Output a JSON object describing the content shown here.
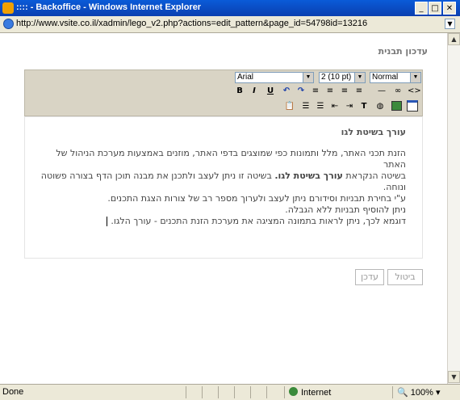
{
  "window": {
    "title": ":::: - Backoffice - Windows Internet Explorer",
    "address": "http://www.vsite.co.il/xadmin/lego_v2.php?actions=edit_pattern&page_id=54798id=13216"
  },
  "page": {
    "heading": "עדכון תבנית"
  },
  "toolbar": {
    "font_family": "Arial",
    "font_size": "2 (10 pt)",
    "format": "Normal"
  },
  "editor": {
    "title": "עורך בשיטת לגו",
    "line1": "הזנת תכני האתר, מלל ותמונות כפי שמוצגים בדפי האתר, מוזנים באמצעות מערכת הניהול של האתר",
    "line2_a": "בשיטה הנקראת ",
    "line2_b": "עורך בשיטת לגו.",
    "line2_c": " בשיטה זו ניתן לעצב ולתכנן את מבנה תוכן הדף בצורה פשוטה ונוחה.",
    "line3": "ע\"י בחירת תבניות וסידורם ניתן לעצב ולערוך מספר רב של צורות הצגת התכנים.",
    "line4": "ניתן להוסיף תבניות ללא הגבלה.",
    "line5": "דוגמא לכך, ניתן לראות בתמונה המציגה את מערכת הזנת התכנים - עורך הלגו."
  },
  "buttons": {
    "cancel": "ביטול",
    "update": "עדכן"
  },
  "status": {
    "done": "Done",
    "zone": "Internet",
    "zoom": "100%"
  }
}
